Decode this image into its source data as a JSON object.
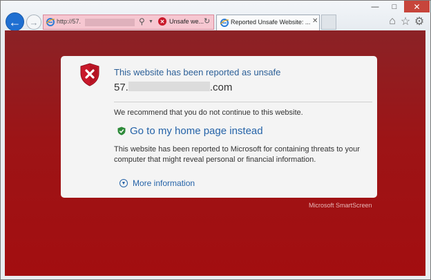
{
  "address_bar": {
    "url": "http://57.",
    "status_text": "Unsafe we..."
  },
  "tab": {
    "title": "Reported Unsafe Website: ..."
  },
  "warning": {
    "title": "This website has been reported as unsafe",
    "domain_prefix": "57.",
    "domain_suffix": ".com",
    "recommendation": "We recommend that you do not continue to this website.",
    "home_link": "Go to my home page instead",
    "body": "This website has been reported to Microsoft for containing threats to your computer that might reveal personal or financial information.",
    "more_info": "More information"
  },
  "footer": {
    "brand": "Microsoft SmartScreen"
  },
  "colors": {
    "page_red": "#a30e10",
    "link_blue": "#2563a8",
    "title_blue": "#2b5f97",
    "shield_red": "#c9182a",
    "safe_green": "#2e8b3a"
  }
}
